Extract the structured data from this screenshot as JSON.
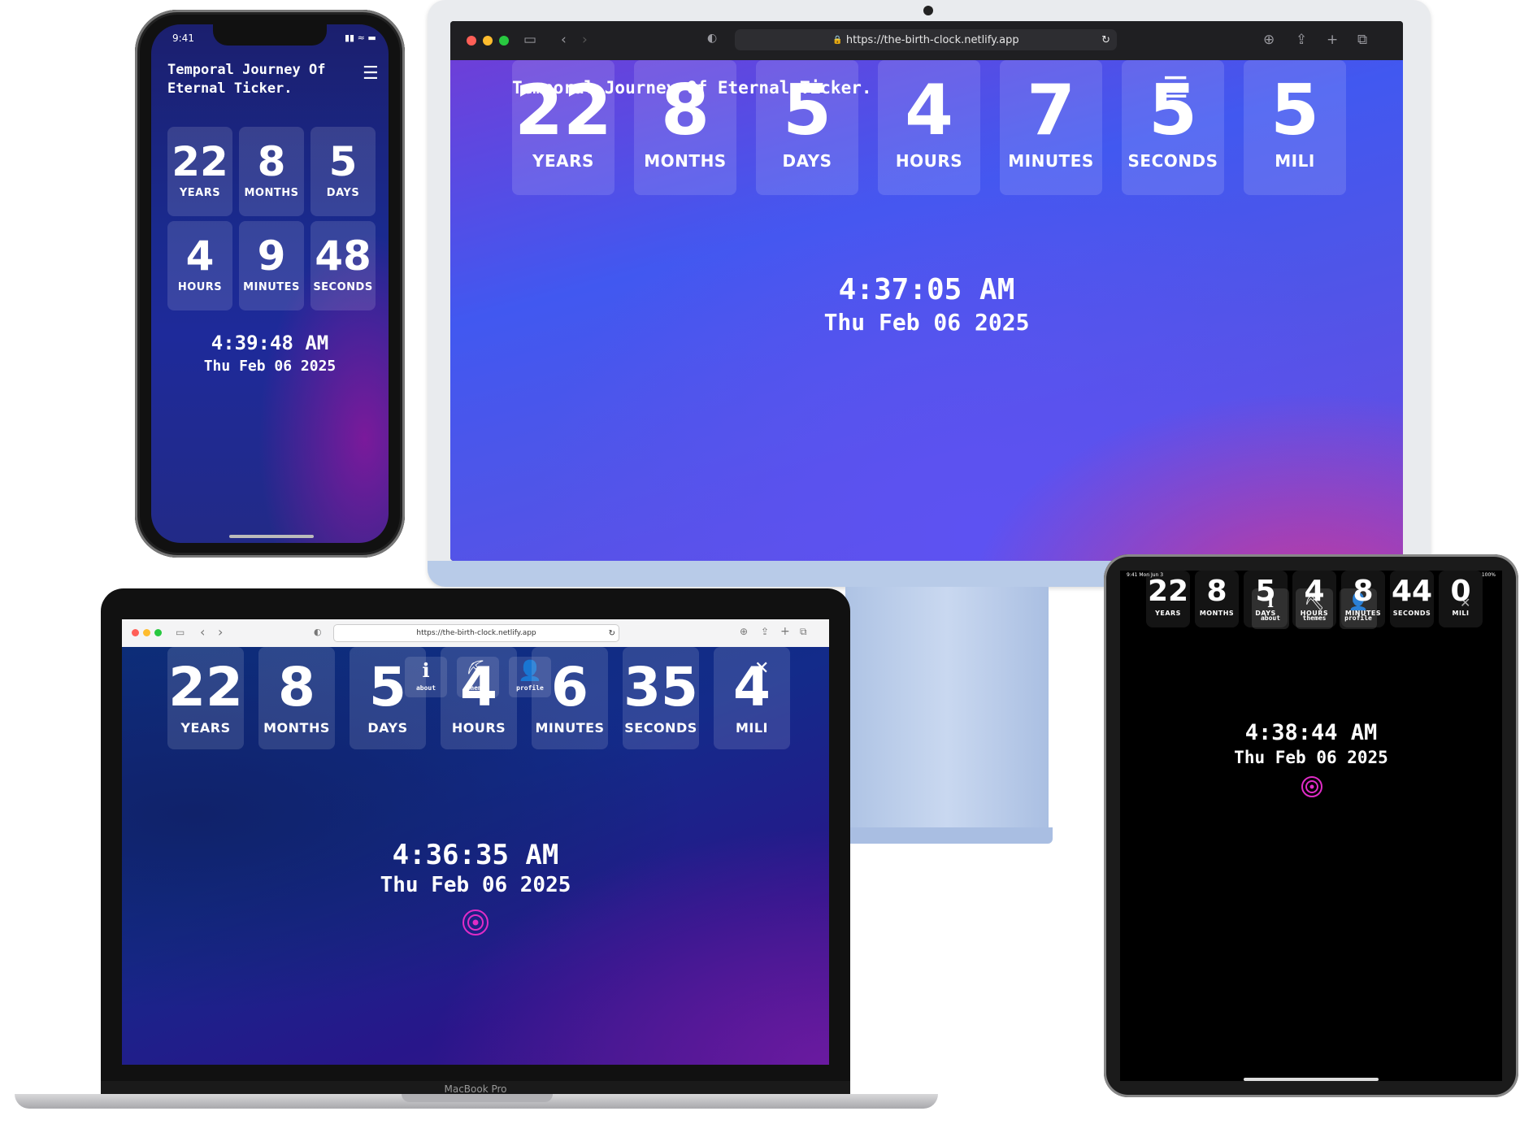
{
  "brand": {
    "title": "Temporal Journey Of Eternal Ticker.",
    "title_line1": "Temporal Journey Of",
    "title_line2": "Eternal Ticker."
  },
  "imac": {
    "url": "https://the-birth-clock.netlify.app",
    "tiles": [
      {
        "value": "22",
        "label": "YEARS"
      },
      {
        "value": "8",
        "label": "MONTHS"
      },
      {
        "value": "5",
        "label": "DAYS"
      },
      {
        "value": "4",
        "label": "HOURS"
      },
      {
        "value": "7",
        "label": "MINUTES"
      },
      {
        "value": "5",
        "label": "SECONDS"
      },
      {
        "value": "5",
        "label": "MILI"
      }
    ],
    "time": "4:37:05 AM",
    "date": "Thu Feb 06 2025"
  },
  "phone": {
    "status_time": "9:41",
    "tiles": [
      {
        "value": "22",
        "label": "YEARS"
      },
      {
        "value": "8",
        "label": "MONTHS"
      },
      {
        "value": "5",
        "label": "DAYS"
      },
      {
        "value": "4",
        "label": "HOURS"
      },
      {
        "value": "9",
        "label": "MINUTES"
      },
      {
        "value": "48",
        "label": "SECONDS"
      }
    ],
    "time": "4:39:48 AM",
    "date": "Thu Feb 06 2025"
  },
  "macbook": {
    "url": "https://the-birth-clock.netlify.app",
    "menu": [
      {
        "icon": "info-icon",
        "label": "about"
      },
      {
        "icon": "paint-roller-icon",
        "label": "themes"
      },
      {
        "icon": "user-icon",
        "label": "profile"
      }
    ],
    "tiles": [
      {
        "value": "22",
        "label": "YEARS"
      },
      {
        "value": "8",
        "label": "MONTHS"
      },
      {
        "value": "5",
        "label": "DAYS"
      },
      {
        "value": "4",
        "label": "HOURS"
      },
      {
        "value": "6",
        "label": "MINUTES"
      },
      {
        "value": "35",
        "label": "SECONDS"
      },
      {
        "value": "4",
        "label": "MILI"
      }
    ],
    "time": "4:36:35 AM",
    "date": "Thu Feb 06 2025",
    "chin_label": "MacBook Pro"
  },
  "ipad": {
    "status_left": "9:41 Mon Jun 3",
    "status_right": "100%",
    "menu": [
      {
        "icon": "info-icon",
        "label": "about"
      },
      {
        "icon": "paint-roller-icon",
        "label": "themes"
      },
      {
        "icon": "user-icon",
        "label": "profile"
      }
    ],
    "tiles": [
      {
        "value": "22",
        "label": "YEARS"
      },
      {
        "value": "8",
        "label": "MONTHS"
      },
      {
        "value": "5",
        "label": "DAYS"
      },
      {
        "value": "4",
        "label": "HOURS"
      },
      {
        "value": "8",
        "label": "MINUTES"
      },
      {
        "value": "44",
        "label": "SECONDS"
      },
      {
        "value": "0",
        "label": "MILI"
      }
    ],
    "time": "4:38:44 AM",
    "date": "Thu Feb 06 2025"
  },
  "colors": {
    "accent_ring": "#e02cc7",
    "imac_bg": "#4f55e8",
    "macbook_bg": "#132b8a"
  }
}
